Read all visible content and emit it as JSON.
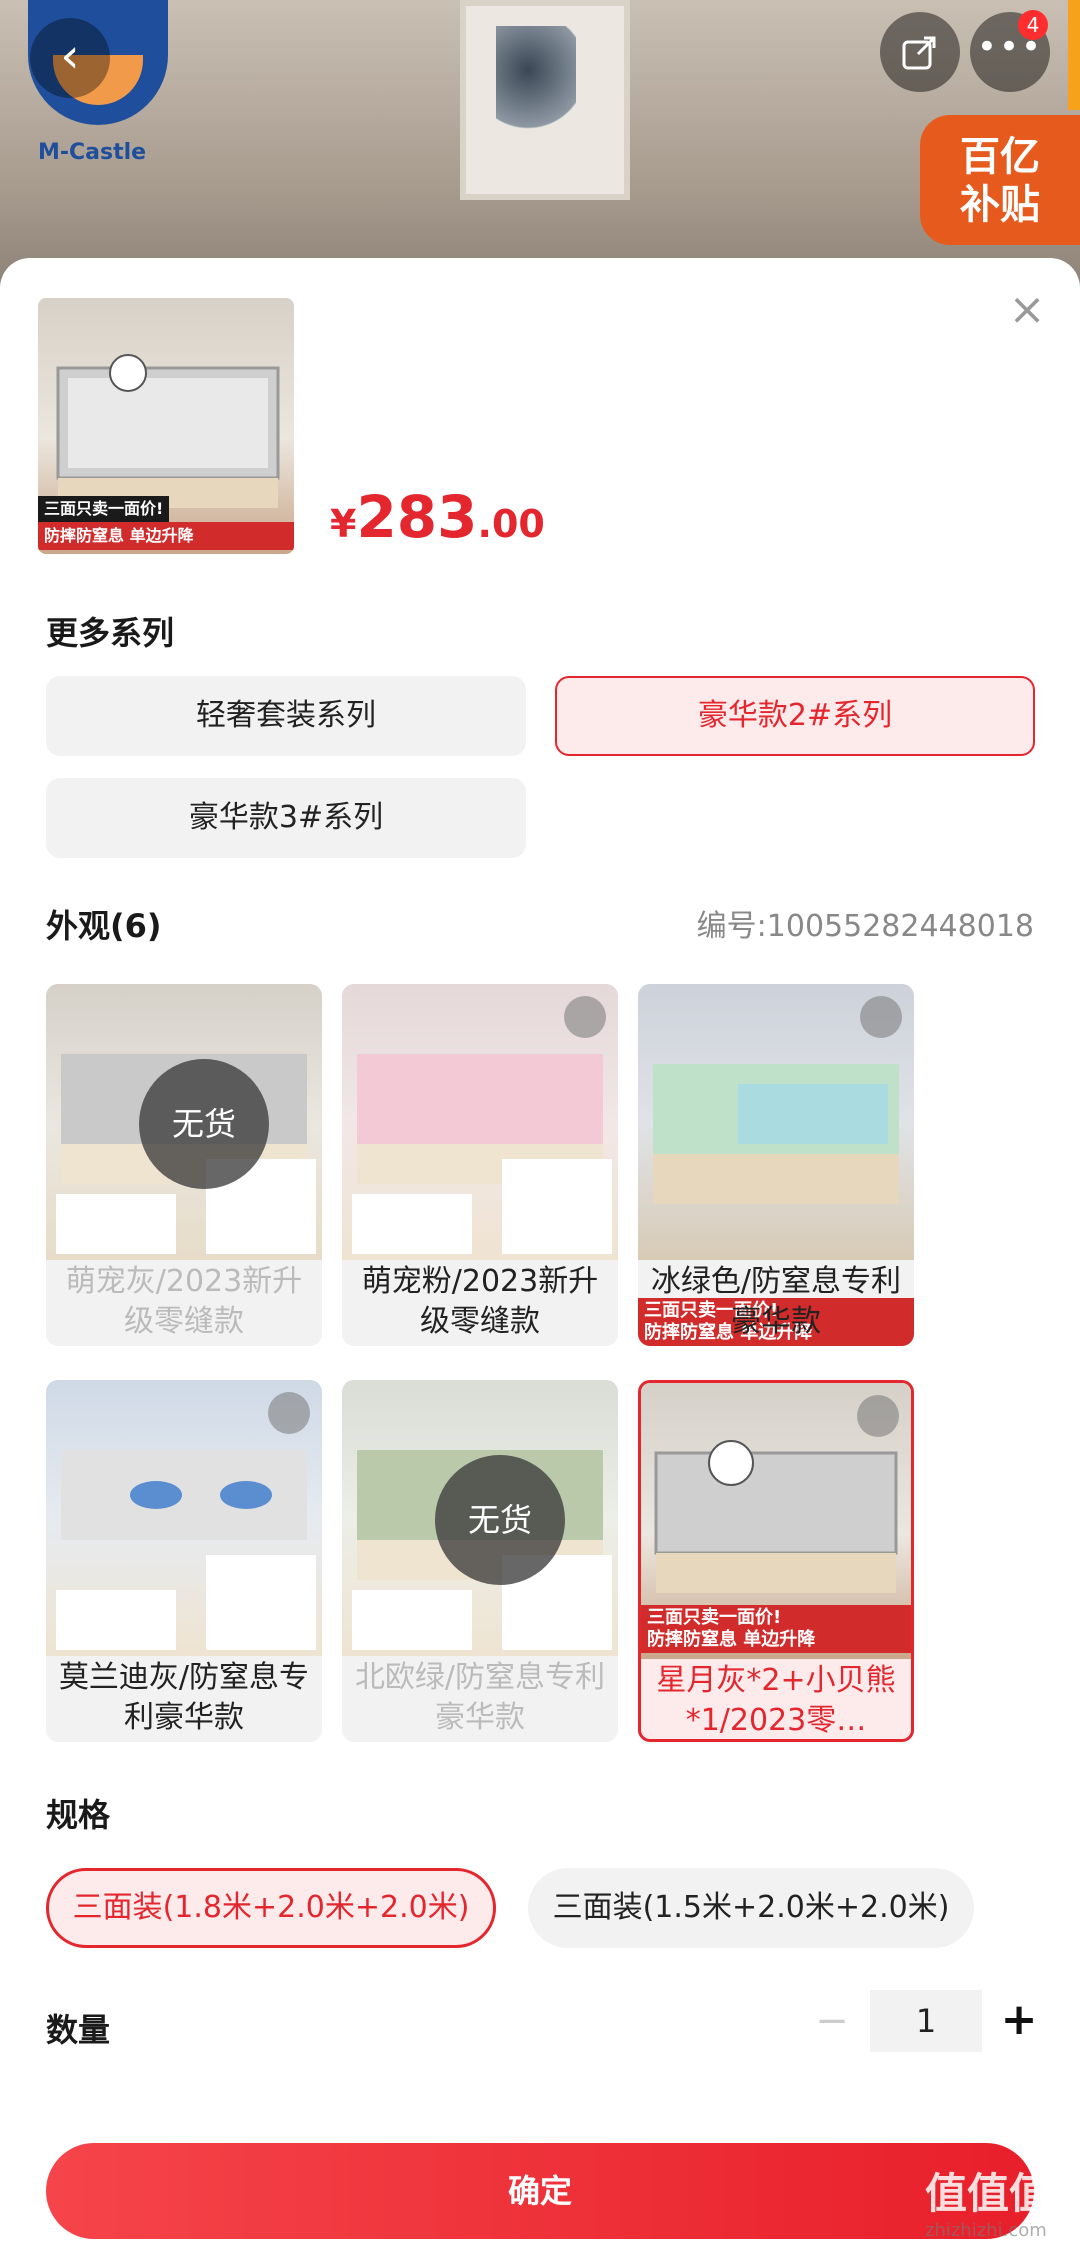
{
  "header": {
    "brand_text": "M-Castle",
    "back_icon": "chevron-left-icon",
    "share_icon": "share-icon",
    "more_icon": "more-icon",
    "more_badge": "4",
    "subsidy_line1": "百亿",
    "subsidy_line2": "补贴"
  },
  "product": {
    "price_currency": "¥",
    "price_integer": "283",
    "price_decimal": ".00",
    "thumb_line1": "三面只卖一面价!",
    "thumb_line2": "防摔防窒息 单边升降"
  },
  "series": {
    "title": "更多系列",
    "options": [
      {
        "label": "轻奢套装系列",
        "selected": false
      },
      {
        "label": "豪华款2#系列",
        "selected": true
      },
      {
        "label": "豪华款3#系列",
        "selected": false
      }
    ]
  },
  "appearance": {
    "title": "外观(6)",
    "code": "编号:10055282448018",
    "out_of_stock_label": "无货",
    "items": [
      {
        "label": "萌宠灰/2023新升级零缝款",
        "status": "out_of_stock",
        "selected": false
      },
      {
        "label": "萌宠粉/2023新升级零缝款",
        "status": "available",
        "selected": false
      },
      {
        "label": "冰绿色/防窒息专利豪华款",
        "status": "available",
        "selected": false
      },
      {
        "label": "莫兰迪灰/防窒息专利豪华款",
        "status": "available",
        "selected": false
      },
      {
        "label": "北欧绿/防窒息专利豪华款",
        "status": "out_of_stock",
        "selected": false
      },
      {
        "label": "星月灰*2+小贝熊*1/2023零…",
        "status": "available",
        "selected": true
      }
    ]
  },
  "spec": {
    "title": "规格",
    "options": [
      {
        "label": "三面装(1.8米+2.0米+2.0米)",
        "selected": true
      },
      {
        "label": "三面装(1.5米+2.0米+2.0米)",
        "selected": false
      }
    ]
  },
  "quantity": {
    "title": "数量",
    "value": "1",
    "minus": "−",
    "plus": "+"
  },
  "confirm_label": "确定",
  "watermark": "值值值",
  "watermark_domain": "zhizhizhi.com",
  "colors": {
    "accent": "#e4262e",
    "selected_bg": "#fdeaea",
    "option_bg": "#f2f2f2"
  }
}
